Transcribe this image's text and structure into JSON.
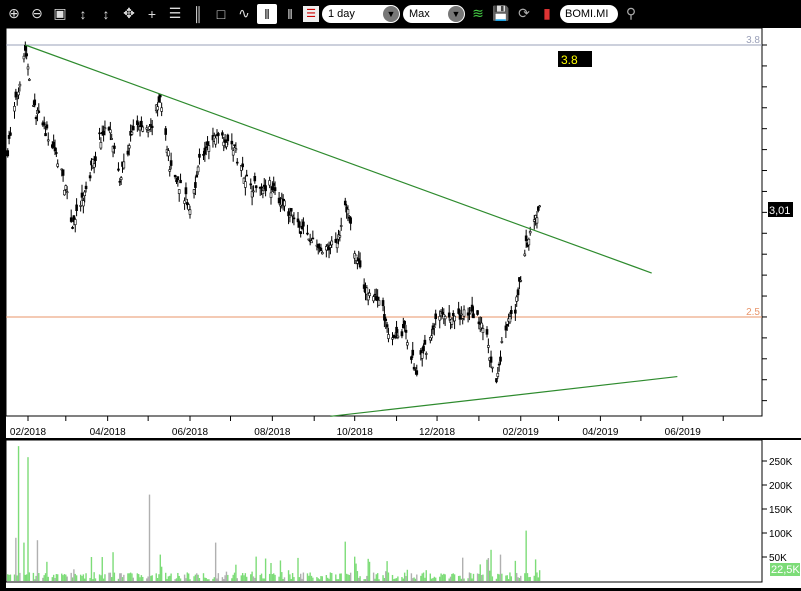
{
  "toolbar": {
    "interval": "1 day",
    "range": "Max",
    "symbol": "BOMI.MI",
    "icons": [
      "zoom-in-icon",
      "zoom-out-icon",
      "fit-icon",
      "zoom-in-vertical-icon",
      "zoom-out-vertical-icon",
      "auto-fit-icon",
      "crosshair-icon",
      "horizontal-grid-icon",
      "vertical-grid-icon",
      "window-icon",
      "line-chart-icon",
      "candle-chart-icon",
      "ohlc-chart-icon",
      "indicators-icon",
      "studies-icon",
      "save-icon",
      "refresh-icon",
      "export-icon",
      "search-icon"
    ]
  },
  "price_panel": {
    "level_high_label": "3.8",
    "level_low_label": "2.5",
    "last_price_label": "3,01",
    "badge_label": "3.8",
    "level_high_color": "#9aa0b8",
    "level_low_color": "#e8956a",
    "badge_color": "#ffff00"
  },
  "volume_panel": {
    "axis_labels": [
      "250K",
      "200K",
      "150K",
      "100K",
      "50K"
    ],
    "last_volume_label": "22,5K",
    "bar_color": "#7ddc78",
    "alt_bar_color": "#b0b0b0"
  },
  "chart_data": {
    "type": "ohlc",
    "x_tick_labels": [
      "02/2018",
      "04/2018",
      "06/2018",
      "08/2018",
      "10/2018",
      "12/2018",
      "02/2019",
      "04/2019",
      "06/2019"
    ],
    "ylim": [
      2.0,
      3.88
    ],
    "horizontal_levels": [
      3.8,
      2.5
    ],
    "last_price": 3.01,
    "price_path": [
      [
        "2018-01-17",
        3.3
      ],
      [
        "2018-01-30",
        3.79
      ],
      [
        "2018-02-06",
        3.49
      ],
      [
        "2018-02-17",
        3.35
      ],
      [
        "2018-02-25",
        3.23
      ],
      [
        "2018-03-06",
        2.94
      ],
      [
        "2018-03-15",
        3.08
      ],
      [
        "2018-03-26",
        3.35
      ],
      [
        "2018-04-03",
        3.42
      ],
      [
        "2018-04-10",
        3.15
      ],
      [
        "2018-04-21",
        3.42
      ],
      [
        "2018-05-02",
        3.39
      ],
      [
        "2018-05-10",
        3.54
      ],
      [
        "2018-05-17",
        3.23
      ],
      [
        "2018-05-28",
        3.08
      ],
      [
        "2018-06-01",
        3.01
      ],
      [
        "2018-06-08",
        3.25
      ],
      [
        "2018-06-23",
        3.39
      ],
      [
        "2018-07-04",
        3.3
      ],
      [
        "2018-07-15",
        3.13
      ],
      [
        "2018-07-30",
        3.13
      ],
      [
        "2018-08-14",
        2.99
      ],
      [
        "2018-08-29",
        2.87
      ],
      [
        "2018-09-09",
        2.8
      ],
      [
        "2018-09-20",
        2.9
      ],
      [
        "2018-09-24",
        3.06
      ],
      [
        "2018-10-01",
        2.82
      ],
      [
        "2018-10-09",
        2.63
      ],
      [
        "2018-10-20",
        2.58
      ],
      [
        "2018-10-27",
        2.41
      ],
      [
        "2018-11-07",
        2.44
      ],
      [
        "2018-11-15",
        2.24
      ],
      [
        "2018-11-22",
        2.34
      ],
      [
        "2018-12-03",
        2.51
      ],
      [
        "2018-12-14",
        2.48
      ],
      [
        "2018-12-25",
        2.53
      ],
      [
        "2019-01-06",
        2.44
      ],
      [
        "2019-01-13",
        2.15
      ],
      [
        "2019-01-20",
        2.44
      ],
      [
        "2019-01-28",
        2.53
      ],
      [
        "2019-02-04",
        2.82
      ],
      [
        "2019-02-12",
        2.96
      ],
      [
        "2019-02-15",
        3.01
      ]
    ],
    "trendlines": [
      {
        "from": [
          "2018-01-30",
          3.8
        ],
        "to": [
          "2019-05-09",
          2.71
        ],
        "color": "#2e8b2e"
      },
      {
        "from": [
          "2018-09-13",
          2.025
        ],
        "to": [
          "2019-05-28",
          2.215
        ],
        "color": "#2e8b2e"
      }
    ],
    "volume_ylim": [
      0,
      290
    ],
    "volume_unit": "K",
    "volume_base": 12,
    "volume_spikes": [
      [
        "2018-01-23",
        90
      ],
      [
        "2018-01-25",
        281
      ],
      [
        "2018-01-29",
        80
      ],
      [
        "2018-02-01",
        258
      ],
      [
        "2018-02-03",
        120
      ],
      [
        "2018-02-08",
        85
      ],
      [
        "2018-02-15",
        40
      ],
      [
        "2018-03-20",
        50
      ],
      [
        "2018-04-05",
        60
      ],
      [
        "2018-05-02",
        180
      ],
      [
        "2018-05-05",
        95
      ],
      [
        "2018-05-10",
        55
      ],
      [
        "2018-06-20",
        80
      ],
      [
        "2018-09-24",
        82
      ],
      [
        "2018-10-12",
        40
      ],
      [
        "2019-01-10",
        65
      ],
      [
        "2019-01-17",
        55
      ],
      [
        "2019-02-05",
        105
      ],
      [
        "2019-02-12",
        45
      ],
      [
        "2019-02-15",
        22.5
      ]
    ]
  }
}
